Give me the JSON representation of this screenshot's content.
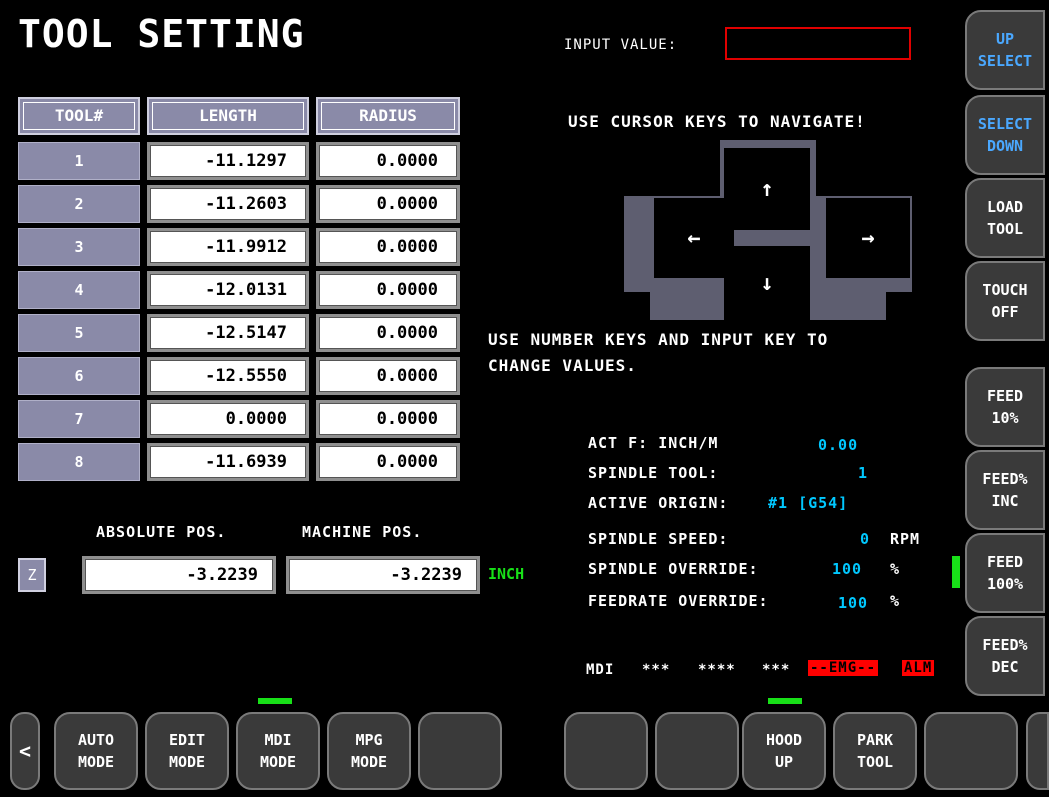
{
  "title": "TOOL SETTING",
  "input": {
    "label": "INPUT VALUE:",
    "value": ""
  },
  "side_buttons": [
    {
      "label": "UP\nSELECT",
      "color": "#4aa8ff"
    },
    {
      "label": "SELECT\nDOWN",
      "color": "#4aa8ff"
    },
    {
      "label": "LOAD\nTOOL",
      "color": "#ffffff"
    },
    {
      "label": "TOUCH\nOFF",
      "color": "#ffffff"
    },
    {
      "label": "FEED\n10%",
      "color": "#ffffff"
    },
    {
      "label": "FEED%\nINC",
      "color": "#ffffff"
    },
    {
      "label": "FEED\n100%",
      "color": "#ffffff"
    },
    {
      "label": "FEED%\nDEC",
      "color": "#ffffff"
    }
  ],
  "table": {
    "headers": [
      "TOOL#",
      "LENGTH",
      "RADIUS"
    ],
    "rows": [
      {
        "tool": "1",
        "length": "-11.1297",
        "radius": "0.0000"
      },
      {
        "tool": "2",
        "length": "-11.2603",
        "radius": "0.0000"
      },
      {
        "tool": "3",
        "length": "-11.9912",
        "radius": "0.0000"
      },
      {
        "tool": "4",
        "length": "-12.0131",
        "radius": "0.0000"
      },
      {
        "tool": "5",
        "length": "-12.5147",
        "radius": "0.0000"
      },
      {
        "tool": "6",
        "length": "-12.5550",
        "radius": "0.0000"
      },
      {
        "tool": "7",
        "length": "0.0000",
        "radius": "0.0000"
      },
      {
        "tool": "8",
        "length": "-11.6939",
        "radius": "0.0000"
      }
    ]
  },
  "nav": {
    "hint": "USE CURSOR KEYS TO NAVIGATE!",
    "up": "↑",
    "down": "↓",
    "left": "←",
    "right": "→",
    "number_hint_1": "USE NUMBER KEYS AND INPUT KEY TO",
    "number_hint_2": "CHANGE VALUES."
  },
  "position": {
    "abs_label": "ABSOLUTE POS.",
    "mach_label": "MACHINE POS.",
    "axis": "Z",
    "abs_value": "-3.2239",
    "mach_value": "-3.2239",
    "unit": "INCH"
  },
  "status_info": {
    "act_f_label": "ACT F: INCH/M",
    "act_f_value": "0.00",
    "spindle_tool_label": "SPINDLE TOOL:",
    "spindle_tool_value": "1",
    "active_origin_label": "ACTIVE ORIGIN:",
    "active_origin_value": "#1 [G54]",
    "spindle_speed_label": "SPINDLE SPEED:",
    "spindle_speed_value": "0",
    "spindle_speed_unit": "RPM",
    "spindle_override_label": "SPINDLE OVERRIDE:",
    "spindle_override_value": "100",
    "spindle_override_unit": "%",
    "feed_override_label": "FEEDRATE OVERRIDE:",
    "feed_override_value": "100",
    "feed_override_unit": "%"
  },
  "status_bar": {
    "mode": "MDI",
    "s1": "***",
    "s2": "****",
    "s3": "***",
    "emg": "--EMG--",
    "alm": "ALM"
  },
  "bottom_buttons": [
    {
      "label": "<",
      "active": false
    },
    {
      "label": "AUTO\nMODE",
      "active": false
    },
    {
      "label": "EDIT\nMODE",
      "active": false
    },
    {
      "label": "MDI\nMODE",
      "active": true
    },
    {
      "label": "MPG\nMODE",
      "active": false
    },
    {
      "label": "",
      "active": false
    },
    {
      "label": "",
      "active": false
    },
    {
      "label": "",
      "active": false
    },
    {
      "label": "HOOD\nUP",
      "active": true
    },
    {
      "label": "PARK\nTOOL",
      "active": false
    },
    {
      "label": "",
      "active": false
    },
    {
      "label": "",
      "active": false
    }
  ]
}
